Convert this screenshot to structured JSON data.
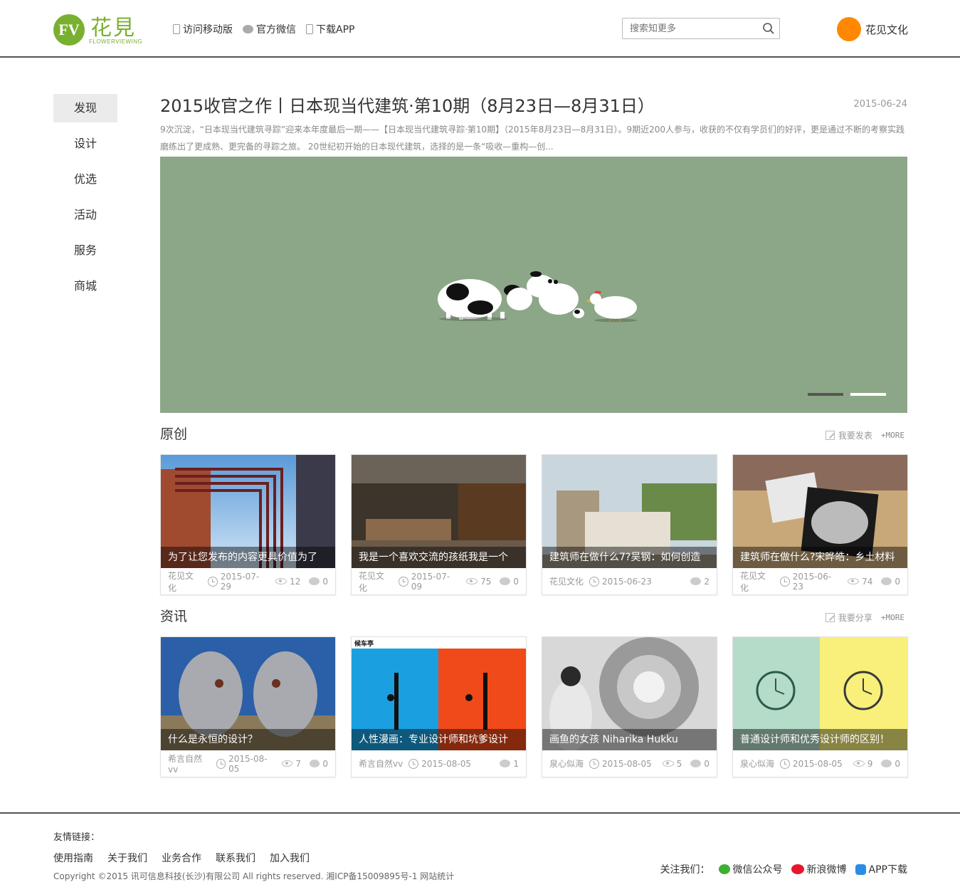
{
  "header": {
    "logo_mark": "FV",
    "logo_cn": "花見",
    "logo_en": "FLOWERVIEWING",
    "links": [
      {
        "label": "访问移动版",
        "icon": "phone-icon"
      },
      {
        "label": "官方微信",
        "icon": "wechat-icon"
      },
      {
        "label": "下载APP",
        "icon": "app-icon"
      }
    ],
    "search_placeholder": "搜索知更多",
    "user_name": "花见文化"
  },
  "sidebar": {
    "items": [
      {
        "label": "发现",
        "active": true
      },
      {
        "label": "设计",
        "active": false
      },
      {
        "label": "优选",
        "active": false
      },
      {
        "label": "活动",
        "active": false
      },
      {
        "label": "服务",
        "active": false
      },
      {
        "label": "商城",
        "active": false
      }
    ]
  },
  "featured": {
    "title": "2015收官之作丨日本现当代建筑·第10期（8月23日—8月31日）",
    "date": "2015-06-24",
    "excerpt": "9次沉淀，“日本现当代建筑寻踪”迎来本年度最后一期——【日本现当代建筑寻踪·第10期】（2015年8月23日—8月31日）。9期近200人参与，收获的不仅有学员们的好评，更是通过不断的考察实践磨练出了更成熟、更完备的寻踪之旅。 20世纪初开始的日本现代建筑，选择的是一条“吸收—重构—创...",
    "banner_color": "#8ca787"
  },
  "sections": [
    {
      "title": "原创",
      "action_label": "我要发表",
      "more_label": "+MORE",
      "cards": [
        {
          "caption": "为了让您发布的内容更具价值为了",
          "author": "花见文化",
          "date": "2015-07-29",
          "views": "12",
          "comments": "0"
        },
        {
          "caption": "我是一个喜欢交流的孩纸我是一个",
          "author": "花见文化",
          "date": "2015-07-09",
          "views": "75",
          "comments": "0"
        },
        {
          "caption": "建筑师在做什么7?吴钢：如何创造",
          "author": "花见文化",
          "date": "2015-06-23",
          "views": "",
          "comments": "2"
        },
        {
          "caption": "建筑师在做什么?宋晔皓：乡土材料",
          "author": "花见文化",
          "date": "2015-06-23",
          "views": "74",
          "comments": "0"
        }
      ]
    },
    {
      "title": "资讯",
      "action_label": "我要分享",
      "more_label": "+MORE",
      "cards": [
        {
          "caption": "什么是永恒的设计？",
          "author": "希言自然vv",
          "date": "2015-08-05",
          "views": "7",
          "comments": "0"
        },
        {
          "caption": "人性漫画：专业设计师和坑爹设计",
          "author": "希言自然vv",
          "date": "2015-08-05",
          "views": "",
          "comments": "1",
          "thumb_label": "候车亭"
        },
        {
          "caption": "画鱼的女孩 Niharika Hukku",
          "author": "泉心似海",
          "date": "2015-08-05",
          "views": "5",
          "comments": "0"
        },
        {
          "caption": "普通设计师和优秀设计师的区别！",
          "author": "泉心似海",
          "date": "2015-08-05",
          "views": "9",
          "comments": "0"
        }
      ]
    }
  ],
  "footer": {
    "friend_label": "友情链接：",
    "links": [
      "使用指南",
      "关于我们",
      "业务合作",
      "联系我们",
      "加入我们"
    ],
    "copyright": "Copyright ©2015 讯可信息科技(长沙)有限公司 All rights reserved. 湘ICP备15009895号-1 网站统计",
    "follow_label": "关注我们：",
    "follow": [
      {
        "label": "微信公众号",
        "icon": "wechat-icon"
      },
      {
        "label": "新浪微博",
        "icon": "weibo-icon"
      },
      {
        "label": "APP下载",
        "icon": "app-download-icon"
      }
    ]
  }
}
